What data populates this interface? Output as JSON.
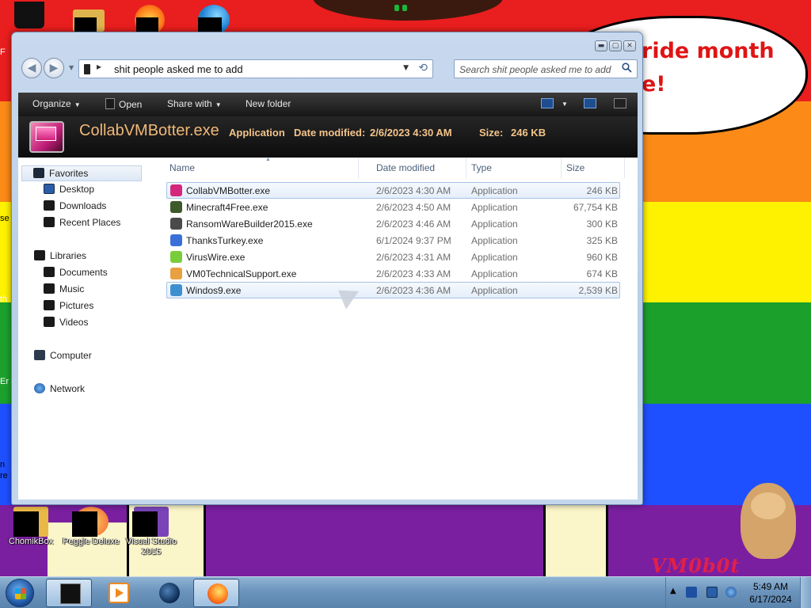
{
  "wallpaper": {
    "speech_text": "ride month e!",
    "logo_text": "VM0b0t"
  },
  "desktop_icons": [
    {
      "label": "ChomikBox"
    },
    {
      "label": "Peggle Deluxe"
    },
    {
      "label": "Visual Studio 2015"
    }
  ],
  "desktop_edge_fragments": [
    "F",
    "se",
    "th",
    "Er",
    "n re"
  ],
  "window": {
    "controls": {
      "minimize": "▬",
      "maximize": "▢",
      "close": "✕"
    },
    "nav": {
      "back": "◀",
      "forward": "▶",
      "history_dropdown": "▼"
    },
    "address": {
      "path": "shit people asked me to add",
      "separator": "▸",
      "dropdown": "▼",
      "refresh": "⟲"
    },
    "search": {
      "placeholder": "Search shit people asked me to add",
      "icon": "search-icon"
    },
    "toolbar": {
      "organize": "Organize",
      "open": "Open",
      "share_with": "Share with",
      "new_folder": "New folder",
      "dropdown_caret": "▼"
    },
    "details": {
      "file_name": "CollabVMBotter.exe",
      "file_type": "Application",
      "date_modified_label": "Date modified:",
      "date_modified_value": "2/6/2023 4:30 AM",
      "size_label": "Size:",
      "size_value": "246 KB"
    },
    "sidebar": {
      "favorites": "Favorites",
      "favorites_items": [
        "Desktop",
        "Downloads",
        "Recent Places"
      ],
      "libraries": "Libraries",
      "libraries_items": [
        "Documents",
        "Music",
        "Pictures",
        "Videos"
      ],
      "computer": "Computer",
      "network": "Network"
    },
    "columns": {
      "name": "Name",
      "date_modified": "Date modified",
      "type": "Type",
      "size": "Size",
      "sort_indicator": "▲"
    },
    "files": [
      {
        "name": "CollabVMBotter.exe",
        "date": "2/6/2023 4:30 AM",
        "type": "Application",
        "size": "246 KB",
        "icon_color": "#d4267c"
      },
      {
        "name": "Minecraft4Free.exe",
        "date": "2/6/2023 4:50 AM",
        "type": "Application",
        "size": "67,754 KB",
        "icon_color": "#3c5a2a"
      },
      {
        "name": "RansomWareBuilder2015.exe",
        "date": "2/6/2023 4:46 AM",
        "type": "Application",
        "size": "300 KB",
        "icon_color": "#4a4a4a"
      },
      {
        "name": "ThanksTurkey.exe",
        "date": "6/1/2024 9:37 PM",
        "type": "Application",
        "size": "325 KB",
        "icon_color": "#3a6fd8"
      },
      {
        "name": "VirusWire.exe",
        "date": "2/6/2023 4:31 AM",
        "type": "Application",
        "size": "960 KB",
        "icon_color": "#7acd3a"
      },
      {
        "name": "VM0TechnicalSupport.exe",
        "date": "2/6/2023 4:33 AM",
        "type": "Application",
        "size": "674 KB",
        "icon_color": "#e8a040"
      },
      {
        "name": "Windos9.exe",
        "date": "2/6/2023 4:36 AM",
        "type": "Application",
        "size": "2,539 KB",
        "icon_color": "#3d8fd0"
      }
    ]
  },
  "taskbar": {
    "buttons": [
      "explorer",
      "media-player",
      "browser",
      "firefox"
    ],
    "clock_time": "5:49 AM",
    "clock_date": "6/17/2024",
    "tray_chevron": "▲"
  }
}
